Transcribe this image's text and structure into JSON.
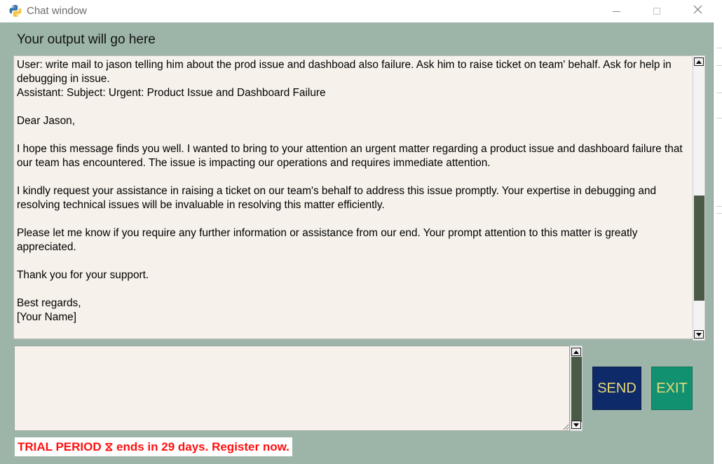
{
  "window": {
    "title": "Chat window"
  },
  "output": {
    "label": "Your output will go here",
    "text": "User: write mail to jason telling him about the prod issue and dashboad also failure. Ask him to raise ticket on team' behalf. Ask for help in debugging in issue.\nAssistant: Subject: Urgent: Product Issue and Dashboard Failure\n\nDear Jason,\n\nI hope this message finds you well. I wanted to bring to your attention an urgent matter regarding a product issue and dashboard failure that our team has encountered. The issue is impacting our operations and requires immediate attention.\n\nI kindly request your assistance in raising a ticket on our team's behalf to address this issue promptly. Your expertise in debugging and resolving technical issues will be invaluable in resolving this matter efficiently.\n\nPlease let me know if you require any further information or assistance from our end. Your prompt attention to this matter is greatly appreciated.\n\nThank you for your support.\n\nBest regards,\n[Your Name]"
  },
  "input": {
    "value": ""
  },
  "buttons": {
    "send_label": "SEND",
    "exit_label": "EXIT"
  },
  "trial_banner": {
    "text": "TRIAL PERIOD ⧖ ends in 29 days. Register now."
  },
  "colors": {
    "window_bg": "#9db5a8",
    "text_bg": "#f6f1ea",
    "send_bg": "#0e2a68",
    "exit_bg": "#129170",
    "button_text": "#e9d977",
    "scroll_thumb": "#4b5a46",
    "trial_text": "#ff1010"
  },
  "icons": {
    "app": "python-icon",
    "minimize": "minimize-icon",
    "maximize": "maximize-icon",
    "close": "close-icon"
  }
}
